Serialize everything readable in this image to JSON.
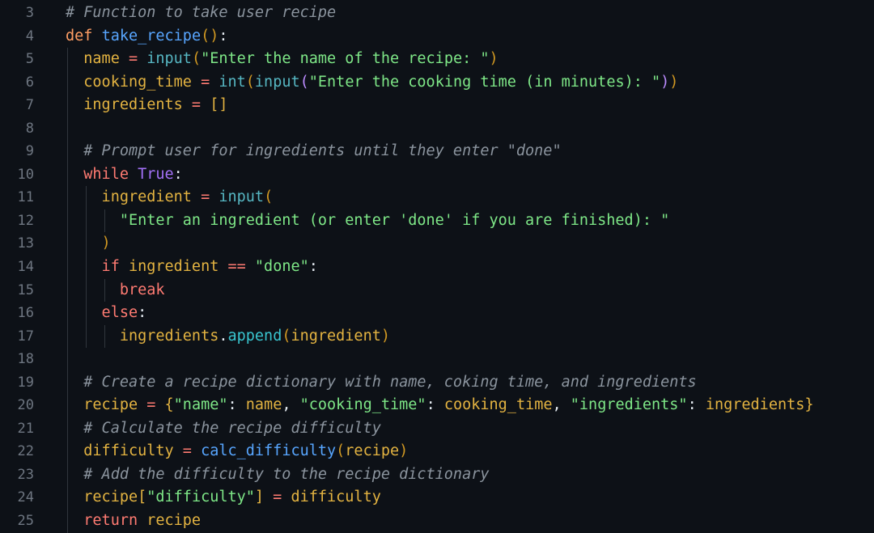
{
  "editor": {
    "lines": [
      {
        "n": "3",
        "indent": 0,
        "tokens": [
          {
            "t": "    # Function to take user recipe",
            "c": "comment"
          }
        ]
      },
      {
        "n": "4",
        "indent": 0,
        "tokens": [
          {
            "t": "    def",
            "c": "kw-def"
          },
          {
            "t": " ",
            "c": "punct"
          },
          {
            "t": "take_recipe",
            "c": "func"
          },
          {
            "t": "()",
            "c": "paren"
          },
          {
            "t": ":",
            "c": "punct"
          }
        ]
      },
      {
        "n": "5",
        "indent": 1,
        "tokens": [
          {
            "t": "      name",
            "c": "var"
          },
          {
            "t": " = ",
            "c": "op"
          },
          {
            "t": "input",
            "c": "builtin"
          },
          {
            "t": "(",
            "c": "paren"
          },
          {
            "t": "\"Enter the name of the recipe: \"",
            "c": "string"
          },
          {
            "t": ")",
            "c": "paren"
          }
        ]
      },
      {
        "n": "6",
        "indent": 1,
        "tokens": [
          {
            "t": "      cooking_time",
            "c": "var"
          },
          {
            "t": " = ",
            "c": "op"
          },
          {
            "t": "int",
            "c": "builtin"
          },
          {
            "t": "(",
            "c": "paren"
          },
          {
            "t": "input",
            "c": "builtin"
          },
          {
            "t": "(",
            "c": "paren2"
          },
          {
            "t": "\"Enter the cooking time (in minutes): \"",
            "c": "string"
          },
          {
            "t": ")",
            "c": "paren2"
          },
          {
            "t": ")",
            "c": "paren"
          }
        ]
      },
      {
        "n": "7",
        "indent": 1,
        "tokens": [
          {
            "t": "      ingredients",
            "c": "var"
          },
          {
            "t": " = ",
            "c": "op"
          },
          {
            "t": "[]",
            "c": "bracket"
          }
        ]
      },
      {
        "n": "8",
        "indent": 1,
        "tokens": []
      },
      {
        "n": "9",
        "indent": 1,
        "tokens": [
          {
            "t": "      # Prompt user for ingredients until they enter \"done\"",
            "c": "comment"
          }
        ]
      },
      {
        "n": "10",
        "indent": 1,
        "tokens": [
          {
            "t": "      while",
            "c": "keyword"
          },
          {
            "t": " ",
            "c": "punct"
          },
          {
            "t": "True",
            "c": "const"
          },
          {
            "t": ":",
            "c": "punct"
          }
        ]
      },
      {
        "n": "11",
        "indent": 2,
        "tokens": [
          {
            "t": "        ingredient",
            "c": "var"
          },
          {
            "t": " = ",
            "c": "op"
          },
          {
            "t": "input",
            "c": "builtin"
          },
          {
            "t": "(",
            "c": "paren"
          }
        ]
      },
      {
        "n": "12",
        "indent": 3,
        "tokens": [
          {
            "t": "          \"Enter an ingredient (or enter 'done' if you are finished): \"",
            "c": "string"
          }
        ]
      },
      {
        "n": "13",
        "indent": 2,
        "tokens": [
          {
            "t": "        )",
            "c": "paren"
          }
        ]
      },
      {
        "n": "14",
        "indent": 2,
        "tokens": [
          {
            "t": "        if",
            "c": "keyword"
          },
          {
            "t": " ingredient",
            "c": "var"
          },
          {
            "t": " == ",
            "c": "op"
          },
          {
            "t": "\"done\"",
            "c": "string"
          },
          {
            "t": ":",
            "c": "punct"
          }
        ]
      },
      {
        "n": "15",
        "indent": 3,
        "tokens": [
          {
            "t": "          break",
            "c": "keyword"
          }
        ]
      },
      {
        "n": "16",
        "indent": 2,
        "tokens": [
          {
            "t": "        else",
            "c": "keyword"
          },
          {
            "t": ":",
            "c": "punct"
          }
        ]
      },
      {
        "n": "17",
        "indent": 3,
        "tokens": [
          {
            "t": "          ingredients",
            "c": "var"
          },
          {
            "t": ".",
            "c": "punct"
          },
          {
            "t": "append",
            "c": "method"
          },
          {
            "t": "(",
            "c": "paren"
          },
          {
            "t": "ingredient",
            "c": "var"
          },
          {
            "t": ")",
            "c": "paren"
          }
        ]
      },
      {
        "n": "18",
        "indent": 1,
        "tokens": []
      },
      {
        "n": "19",
        "indent": 1,
        "tokens": [
          {
            "t": "      # Create a recipe dictionary with name, coking time, and ingredients",
            "c": "comment"
          }
        ]
      },
      {
        "n": "20",
        "indent": 1,
        "tokens": [
          {
            "t": "      recipe",
            "c": "var"
          },
          {
            "t": " = ",
            "c": "op"
          },
          {
            "t": "{",
            "c": "bracket"
          },
          {
            "t": "\"name\"",
            "c": "string"
          },
          {
            "t": ": ",
            "c": "punct"
          },
          {
            "t": "name",
            "c": "var"
          },
          {
            "t": ", ",
            "c": "punct"
          },
          {
            "t": "\"cooking_time\"",
            "c": "string"
          },
          {
            "t": ": ",
            "c": "punct"
          },
          {
            "t": "cooking_time",
            "c": "var"
          },
          {
            "t": ", ",
            "c": "punct"
          },
          {
            "t": "\"ingredients\"",
            "c": "string"
          },
          {
            "t": ": ",
            "c": "punct"
          },
          {
            "t": "ingredients",
            "c": "var"
          },
          {
            "t": "}",
            "c": "bracket"
          }
        ]
      },
      {
        "n": "21",
        "indent": 1,
        "tokens": [
          {
            "t": "      # Calculate the recipe difficulty",
            "c": "comment"
          }
        ]
      },
      {
        "n": "22",
        "indent": 1,
        "tokens": [
          {
            "t": "      difficulty",
            "c": "var"
          },
          {
            "t": " = ",
            "c": "op"
          },
          {
            "t": "calc_difficulty",
            "c": "func"
          },
          {
            "t": "(",
            "c": "paren"
          },
          {
            "t": "recipe",
            "c": "var"
          },
          {
            "t": ")",
            "c": "paren"
          }
        ]
      },
      {
        "n": "23",
        "indent": 1,
        "tokens": [
          {
            "t": "      # Add the difficulty to the recipe dictionary",
            "c": "comment"
          }
        ]
      },
      {
        "n": "24",
        "indent": 1,
        "tokens": [
          {
            "t": "      recipe",
            "c": "var"
          },
          {
            "t": "[",
            "c": "bracket"
          },
          {
            "t": "\"difficulty\"",
            "c": "string"
          },
          {
            "t": "]",
            "c": "bracket"
          },
          {
            "t": " = ",
            "c": "op"
          },
          {
            "t": "difficulty",
            "c": "var"
          }
        ]
      },
      {
        "n": "25",
        "indent": 1,
        "tokens": [
          {
            "t": "      return",
            "c": "keyword"
          },
          {
            "t": " recipe",
            "c": "var"
          }
        ]
      }
    ]
  }
}
